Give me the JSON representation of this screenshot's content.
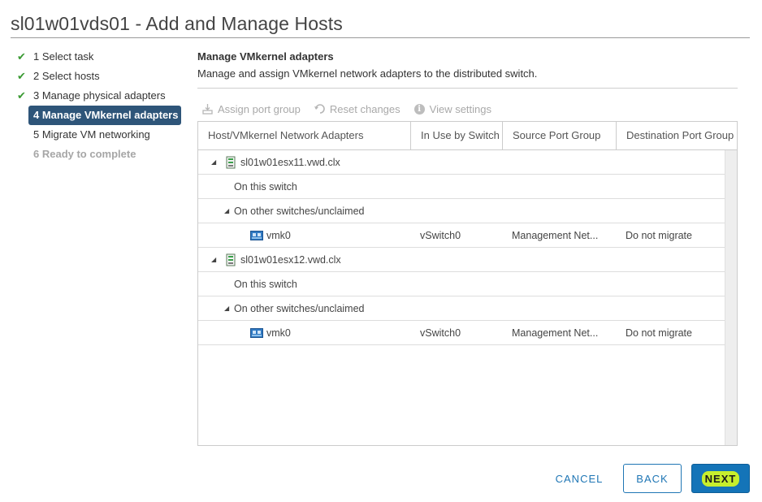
{
  "dialog": {
    "title": "sl01w01vds01 - Add and Manage Hosts"
  },
  "steps": [
    {
      "label": "1 Select task",
      "state": "done"
    },
    {
      "label": "2 Select hosts",
      "state": "done"
    },
    {
      "label": "3 Manage physical adapters",
      "state": "done"
    },
    {
      "label": "4 Manage VMkernel adapters",
      "state": "active"
    },
    {
      "label": "5 Migrate VM networking",
      "state": "pending"
    },
    {
      "label": "6 Ready to complete",
      "state": "disabled"
    }
  ],
  "section": {
    "title": "Manage VMkernel adapters",
    "description": "Manage and assign VMkernel network adapters to the distributed switch."
  },
  "toolbar": {
    "assign_label": "Assign port group",
    "reset_label": "Reset changes",
    "view_label": "View settings"
  },
  "grid": {
    "columns": [
      "Host/VMkernel Network Adapters",
      "In Use by Switch",
      "Source Port Group",
      "Destination Port Group"
    ],
    "rows": [
      {
        "type": "host",
        "name": "sl01w01esx11.vwd.clx"
      },
      {
        "type": "group",
        "name": "On this switch"
      },
      {
        "type": "group-expanded",
        "name": "On other switches/unclaimed"
      },
      {
        "type": "adapter",
        "name": "vmk0",
        "switch": "vSwitch0",
        "source": "Management Net...",
        "destination": "Do not migrate"
      },
      {
        "type": "host",
        "name": "sl01w01esx12.vwd.clx"
      },
      {
        "type": "group",
        "name": "On this switch"
      },
      {
        "type": "group-expanded",
        "name": "On other switches/unclaimed"
      },
      {
        "type": "adapter",
        "name": "vmk0",
        "switch": "vSwitch0",
        "source": "Management Net...",
        "destination": "Do not migrate"
      }
    ]
  },
  "footer": {
    "cancel_label": "CANCEL",
    "back_label": "BACK",
    "next_label": "NEXT"
  },
  "colors": {
    "accent": "#1474b8",
    "active_step": "#2e5579",
    "check": "#3a9a33",
    "highlight": "#c7ef2d"
  }
}
